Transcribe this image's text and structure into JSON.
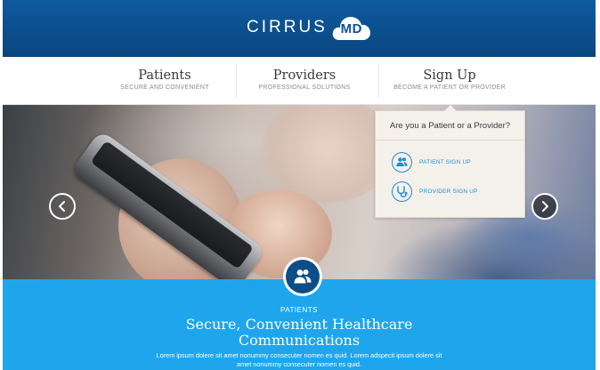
{
  "brand": {
    "name": "CIRRUS",
    "badge": "MD"
  },
  "nav": {
    "items": [
      {
        "title": "Patients",
        "subtitle": "SECURE AND CONVENIENT"
      },
      {
        "title": "Providers",
        "subtitle": "PROFESSIONAL SOLUTIONS"
      },
      {
        "title": "Sign Up",
        "subtitle": "BECOME A PATIENT OR PROVIDER"
      }
    ]
  },
  "hero": {
    "prev_icon": "chevron-left-icon",
    "next_icon": "chevron-right-icon"
  },
  "signup_dropdown": {
    "heading": "Are you a Patient or a Provider?",
    "options": [
      {
        "label": "PATIENT SIGN UP",
        "icon": "patients-icon"
      },
      {
        "label": "PROVIDER SIGN UP",
        "icon": "stethoscope-icon"
      }
    ]
  },
  "feature": {
    "icon": "patients-icon",
    "kicker": "PATIENTS",
    "title_line1": "Secure, Convenient Healthcare",
    "title_line2": "Communications",
    "body": "Lorem ipsum dolere sit amet nonummy consecuter nomen es quid. Lorem adspecit ipsum dolere sit amet nonummy consecuter nomen es quid."
  },
  "colors": {
    "header_blue": "#0b4f8e",
    "accent_blue": "#1a8fd8",
    "section_blue": "#1fa5ec",
    "dropdown_bg": "#f4f1ea"
  }
}
